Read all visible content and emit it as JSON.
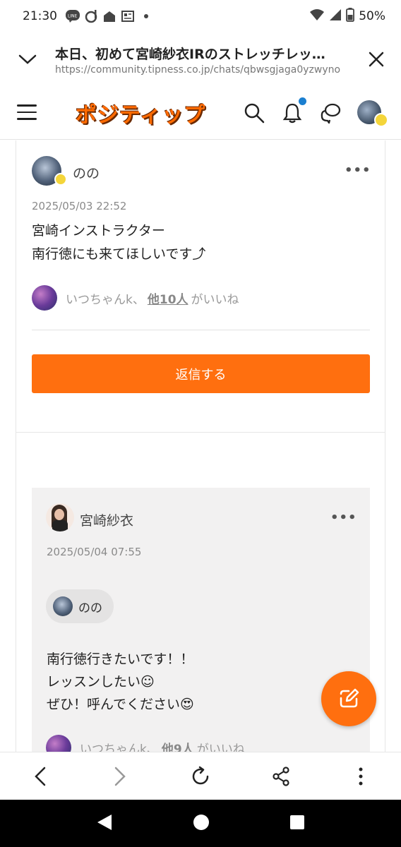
{
  "status_bar": {
    "time": "21:30",
    "battery": "50%",
    "icons_left": [
      "line-icon",
      "d-icon",
      "home-icon",
      "news-icon",
      "dot-icon"
    ],
    "icons_right": [
      "wifi-icon",
      "signal-icon",
      "battery-icon"
    ]
  },
  "browser": {
    "page_title": "本日、初めて宮崎紗衣IRのストレッチレッ…",
    "url": "https://community.tipness.co.jp/chats/qbwsgjaga0yzwyno"
  },
  "site_header": {
    "logo_text": "ポジティップ",
    "notification_dot_color": "#1a7fd0"
  },
  "post": {
    "author": "のの",
    "date": "2025/05/03 22:52",
    "lines": [
      "宮崎インストラクター",
      "南行徳にも来てほしいです⤴"
    ],
    "likes": {
      "first_name": "いつちゃんk",
      "separator": "、",
      "others": "他10人",
      "suffix": "がいいね"
    },
    "reply_button": "返信する"
  },
  "reply": {
    "author": "宮崎紗衣",
    "date": "2025/05/04 07:55",
    "mention": "のの",
    "lines": [
      "南行徳行きたいです！！",
      "レッスンしたい☺",
      "ぜひ！呼んでください😍"
    ],
    "likes": {
      "first_name": "いつちゃんk",
      "separator": "、",
      "others": "他9人",
      "suffix": "がいいね"
    }
  },
  "colors": {
    "accent": "#ff6f0f",
    "reply_bg": "#f2f1f1"
  }
}
